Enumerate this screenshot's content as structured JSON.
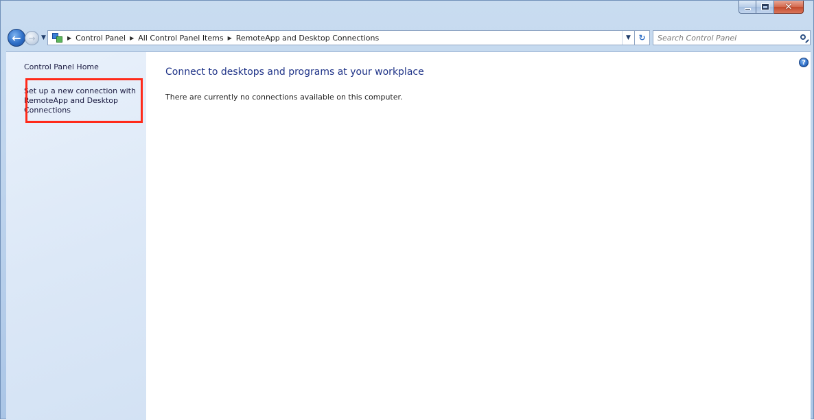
{
  "window": {
    "caption": {
      "minimize": "",
      "maximize": "",
      "close": "✕"
    }
  },
  "nav": {
    "back_glyph": "←",
    "forward_glyph": "→",
    "recent_glyph": "▼",
    "breadcrumbs": [
      {
        "label": "Control Panel"
      },
      {
        "label": "All Control Panel Items"
      },
      {
        "label": "RemoteApp and Desktop Connections"
      }
    ],
    "separator": "▶",
    "dropdown_glyph": "▼",
    "refresh_glyph": "↻"
  },
  "search": {
    "placeholder": "Search Control Panel",
    "value": ""
  },
  "sidebar": {
    "home_label": "Control Panel Home",
    "setup_link": "Set up a new connection with RemoteApp and Desktop Connections"
  },
  "main": {
    "title": "Connect to desktops and programs at your workplace",
    "message": "There are currently no connections available on this computer."
  },
  "help": {
    "glyph": "?"
  },
  "colors": {
    "link": "#1a1a40",
    "title": "#1e3287",
    "highlight": "#ff2a1a",
    "sidebar": "#dce8f7"
  }
}
